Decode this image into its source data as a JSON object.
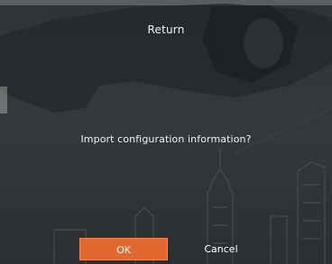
{
  "dialog": {
    "title": "Return",
    "message": "Import configuration information?",
    "ok_label": "OK",
    "cancel_label": "Cancel"
  },
  "colors": {
    "background": "#33373a",
    "ok_button": "#e2682f",
    "text": "#f2f2f2"
  }
}
